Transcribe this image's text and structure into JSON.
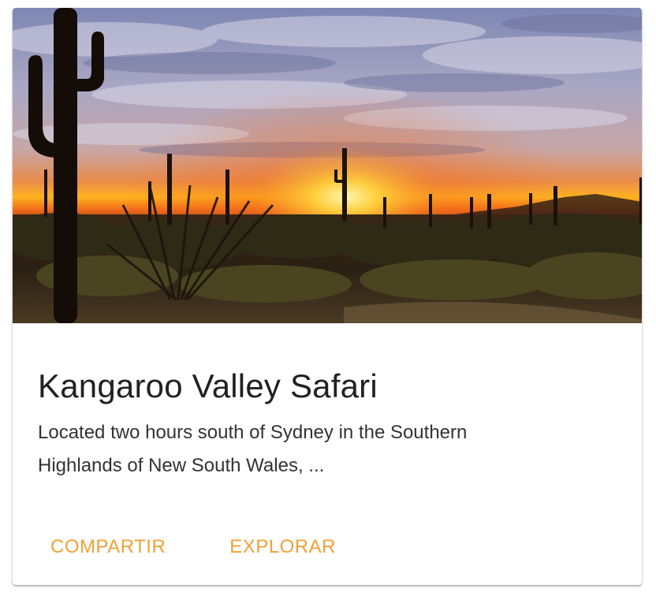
{
  "card": {
    "title": "Kangaroo Valley Safari",
    "description": "Located two hours south of Sydney in the Southern Highlands of New South Wales, ...",
    "image_alt": "Saguaro cactus desert at sunset"
  },
  "actions": {
    "share_label": "COMPARTIR",
    "explore_label": "EXPLORAR"
  },
  "colors": {
    "accent": "#F1A035",
    "title_text": "#212121",
    "body_text": "#333333"
  }
}
